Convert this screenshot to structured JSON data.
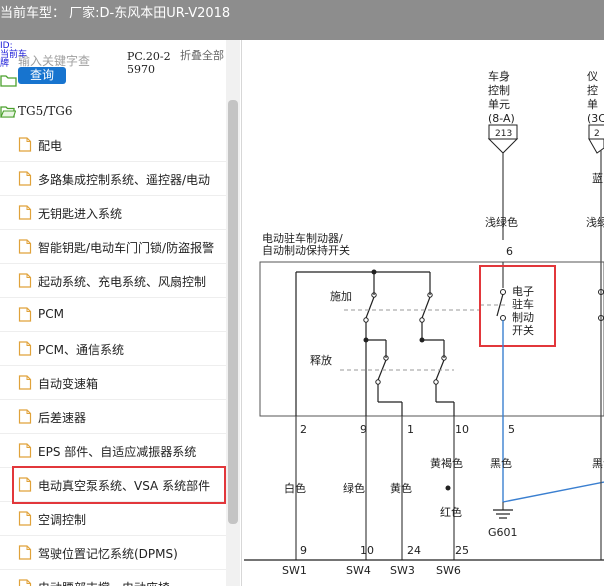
{
  "title_bar": {
    "label": "当前车型：",
    "value": "厂家:D-东风本田UR-V2018"
  },
  "header_tiny": {
    "line1": "ID:",
    "line2": "当前车",
    "line3": "牌"
  },
  "search": {
    "placeholder": "输入关键字查",
    "button_label": "查询"
  },
  "tree": {
    "code": "PC.20-25970",
    "collapse_label": "折叠全部",
    "root_folder": "TG5/TG6",
    "items": [
      {
        "label": "配电"
      },
      {
        "label": "多路集成控制系统、遥控器/电动"
      },
      {
        "label": "无钥匙进入系统"
      },
      {
        "label": "智能钥匙/电动车门门锁/防盗报警"
      },
      {
        "label": "起动系统、充电系统、风扇控制"
      },
      {
        "label": "PCM"
      },
      {
        "label": "PCM、通信系统"
      },
      {
        "label": "自动变速箱"
      },
      {
        "label": "后差速器"
      },
      {
        "label": "EPS 部件、自适应减振器系统"
      },
      {
        "label": "电动真空泵系统、VSA 系统部件"
      },
      {
        "label": "空调控制"
      },
      {
        "label": "驾驶位置记忆系统(DPMS)"
      },
      {
        "label": "电动腰部支撑、电动座椅"
      }
    ],
    "selected_index": 10
  },
  "diagram": {
    "unit1_l1": "车身",
    "unit1_l2": "控制",
    "unit1_l3": "单元",
    "unit1_code": "(8-A)",
    "unit1_pin": "213",
    "unit2_l1": "仪",
    "unit2_l2": "控",
    "unit2_l3": "单",
    "unit2_code": "(3C",
    "unit2_pin": "2",
    "wire_light_green": "浅绿色",
    "wire_light_green2": "浅绿",
    "wire_blue": "蓝",
    "pin6": "6",
    "switch_title1": "电动驻车制动器/",
    "switch_title2": "自动制动保持开关",
    "apply": "施加",
    "release": "释放",
    "esw1": "电子",
    "esw2": "驻车",
    "esw3": "制动",
    "esw4": "开关",
    "pins": {
      "p2": "2",
      "p9": "9",
      "p1": "1",
      "p10": "10",
      "p5": "5"
    },
    "white": "白色",
    "green": "绿色",
    "yellow": "黄色",
    "yellow_brown": "黄褐色",
    "red": "红色",
    "black": "黑色",
    "black2": "黑色",
    "ground": "G601",
    "bottom_pins": {
      "b9": "9",
      "b10": "10",
      "b24": "24",
      "b25": "25"
    },
    "sw1": "SW1",
    "sw4": "SW4",
    "sw3": "SW3",
    "sw6": "SW6"
  }
}
